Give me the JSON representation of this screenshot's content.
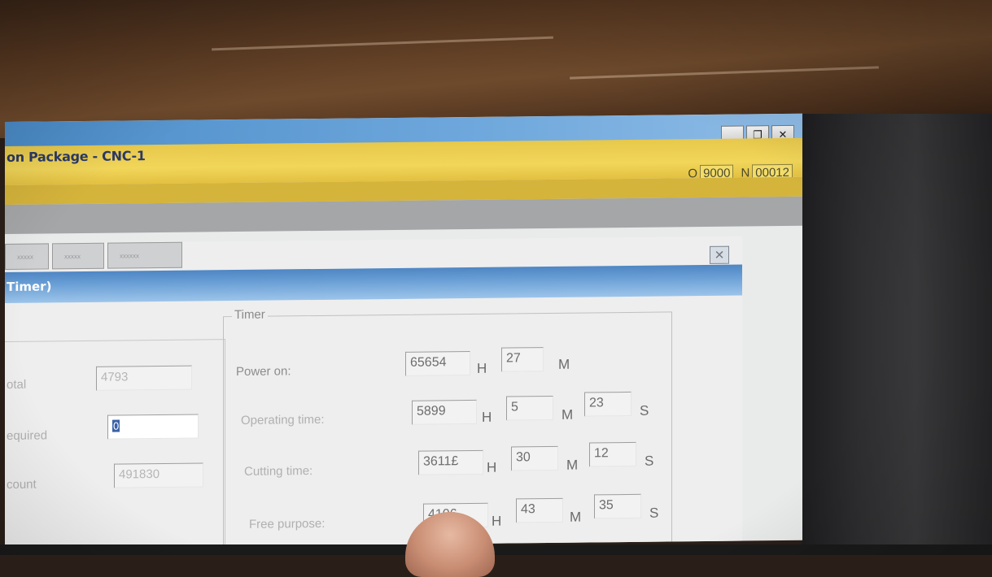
{
  "window": {
    "title": "on Package - CNC-1",
    "minimize_glyph": "_",
    "restore_glyph": "❐",
    "close_glyph": "✕",
    "o_label": "O",
    "o_value": "9000",
    "n_label": "N",
    "n_value": "00012"
  },
  "tabs": [
    {
      "label": "xxxxx"
    },
    {
      "label": "xxxxx"
    },
    {
      "label": "xxxxxx"
    }
  ],
  "dialog": {
    "title": "Timer)",
    "close_glyph": "✕"
  },
  "counter_panel": {
    "rows": [
      {
        "label": "otal",
        "value": "4793"
      },
      {
        "label": "equired",
        "value": "0"
      },
      {
        "label": "count",
        "value": "491830"
      }
    ]
  },
  "timer": {
    "legend": "Timer",
    "rows": [
      {
        "label": "Power on:",
        "hours": "65654",
        "minutes": "27",
        "seconds": null
      },
      {
        "label": "Operating time:",
        "hours": "5899",
        "minutes": "5",
        "seconds": "23"
      },
      {
        "label": "Cutting time:",
        "hours": "3611£",
        "minutes": "30",
        "seconds": "12"
      },
      {
        "label": "Free purpose:",
        "hours": "4106",
        "minutes": "43",
        "seconds": "35"
      }
    ],
    "unit_h": "H",
    "unit_m": "M",
    "unit_s": "S"
  },
  "colors": {
    "title_bar": "#f1d65a",
    "dialog_title_bar": "#6a9fd5",
    "panel_bg": "#eeeeee"
  }
}
